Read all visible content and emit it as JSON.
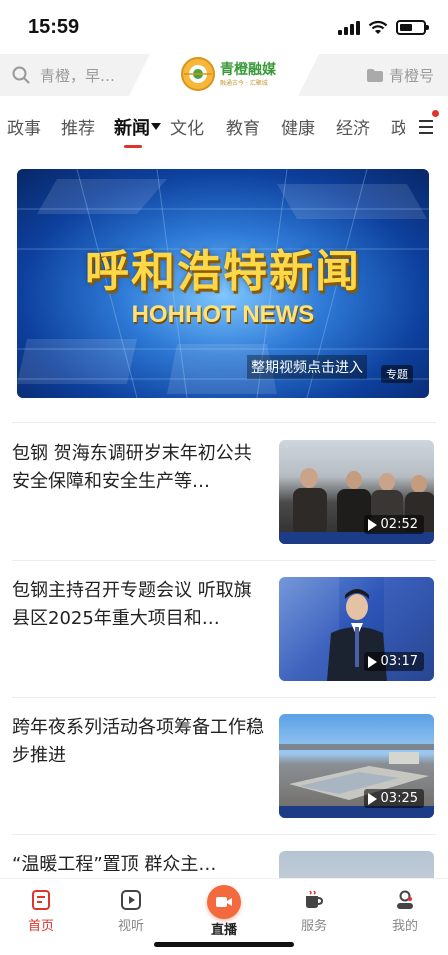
{
  "status_bar": {
    "time": "15:59"
  },
  "header": {
    "search_placeholder": "青橙，早…",
    "logo_text": "青橙融媒",
    "logo_sub": "融通古今 · 汇聚城",
    "qingcheng_label": "青橙号"
  },
  "tabs": [
    "政事",
    "推荐",
    "新闻",
    "文化",
    "教育",
    "健康",
    "经济",
    "政"
  ],
  "active_tab": "新闻",
  "banner": {
    "title": "呼和浩特新闻",
    "subtitle": "HOHHOT NEWS",
    "caption": "整期视频点击进入",
    "tag": "专题"
  },
  "news": [
    {
      "title": "包钢 贺海东调研岁末年初公共安全保障和安全生产等…",
      "duration": "02:52",
      "thumb_caption": "包钢 贺海东调研岁末年初公共安全保障和安全生产等"
    },
    {
      "title": "包钢主持召开专题会议 听取旗县区2025年重大项目和…",
      "duration": "03:17"
    },
    {
      "title": "跨年夜系列活动各项筹备工作稳步推进",
      "duration": "03:25",
      "thumb_caption": "跨年夜系列活动各项筹备工作稳步推进"
    },
    {
      "title": "“温暖工程”置顶 群众主…"
    }
  ],
  "bottom_nav": [
    {
      "label": "首页",
      "icon": "home-icon"
    },
    {
      "label": "视听",
      "icon": "play-icon"
    },
    {
      "label": "直播",
      "icon": "live-icon"
    },
    {
      "label": "服务",
      "icon": "service-cup-icon"
    },
    {
      "label": "我的",
      "icon": "profile-icon"
    }
  ],
  "colors": {
    "accent": "#e0332b",
    "live": "#f26a3d",
    "logo_green": "#3a9a3a"
  }
}
